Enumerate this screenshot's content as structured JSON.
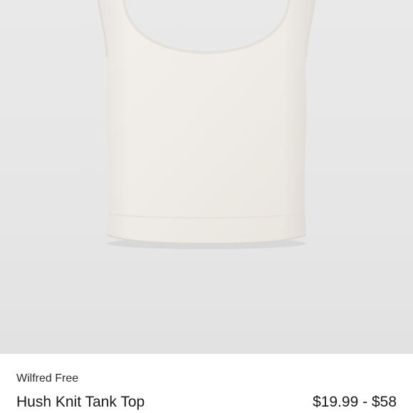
{
  "product": {
    "image_name": "tank-top-photo",
    "brand": "Wilfred Free",
    "title": "Hush Knit Tank Top",
    "price": "$19.99 - $58"
  },
  "colors": {
    "photo_background": "#e7e7e7",
    "garment": "#f1ede8",
    "info_background": "#ffffff",
    "text": "#1a1a1a"
  }
}
